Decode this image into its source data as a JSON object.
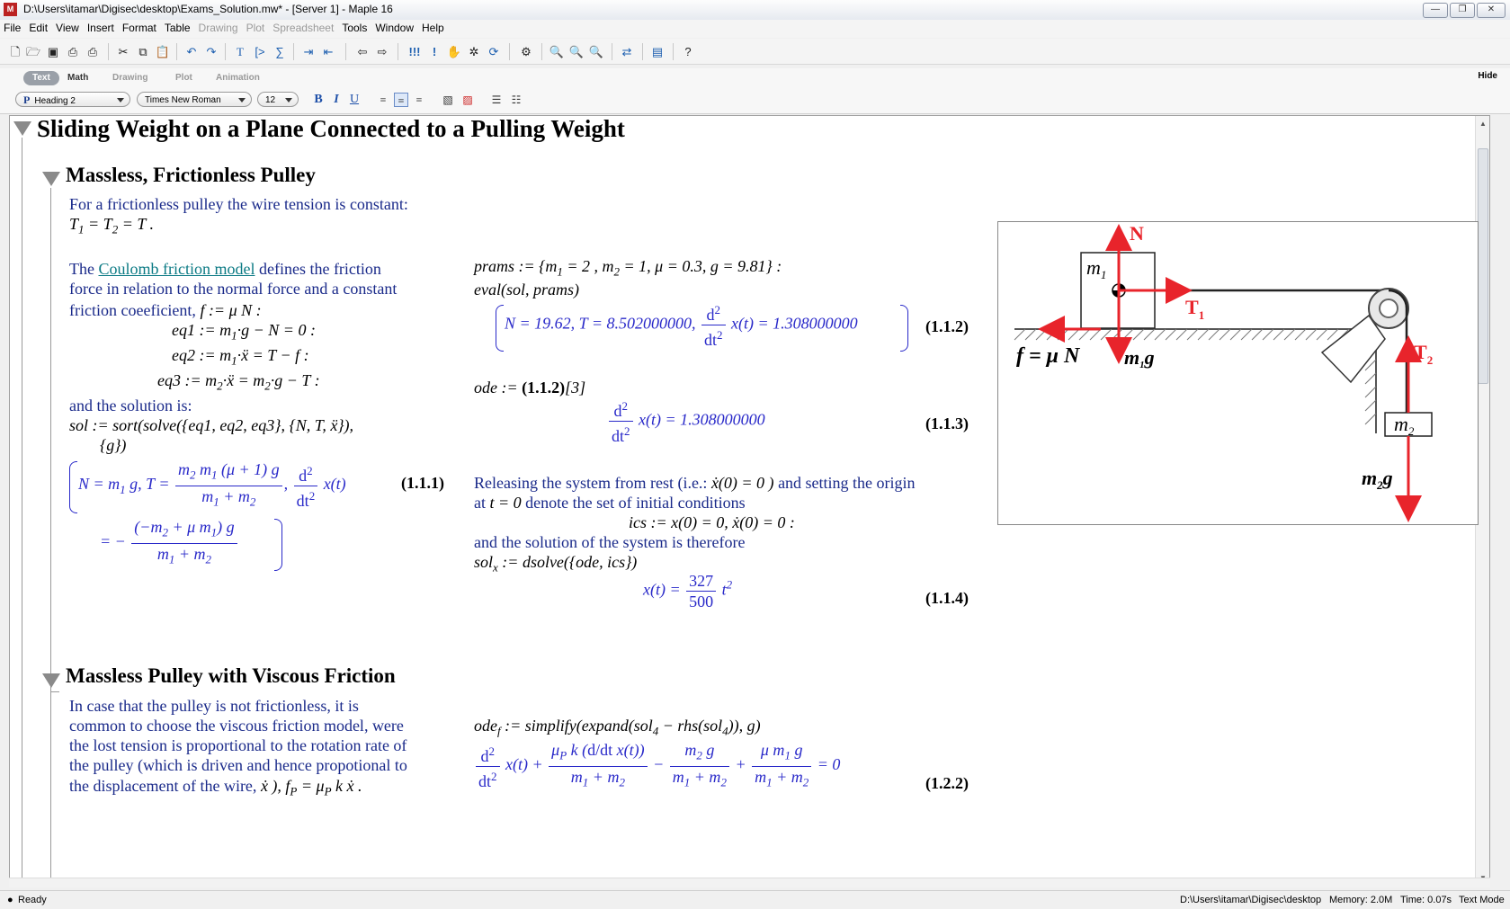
{
  "window": {
    "title": "D:\\Users\\itamar\\Digisec\\desktop\\Exams_Solution.mw* - [Server 1] - Maple 16",
    "app_icon": "maple-leaf-icon"
  },
  "menubar": {
    "items": [
      {
        "label": "File",
        "enabled": true
      },
      {
        "label": "Edit",
        "enabled": true
      },
      {
        "label": "View",
        "enabled": true
      },
      {
        "label": "Insert",
        "enabled": true
      },
      {
        "label": "Format",
        "enabled": true
      },
      {
        "label": "Table",
        "enabled": true
      },
      {
        "label": "Drawing",
        "enabled": false
      },
      {
        "label": "Plot",
        "enabled": false
      },
      {
        "label": "Spreadsheet",
        "enabled": false
      },
      {
        "label": "Tools",
        "enabled": true
      },
      {
        "label": "Window",
        "enabled": true
      },
      {
        "label": "Help",
        "enabled": true
      }
    ]
  },
  "toolbar": {
    "icons": [
      "new-document-icon",
      "open-icon",
      "save-icon",
      "print-icon",
      "print-preview-icon",
      "cut-icon",
      "copy-icon",
      "paste-icon",
      "undo-icon",
      "redo-icon",
      "text-mode-icon",
      "math-prompt-icon",
      "sum-icon",
      "indent-icon",
      "outdent-icon",
      "back-icon",
      "forward-icon",
      "execute-all-icon",
      "execute-icon",
      "interrupt-icon",
      "debug-icon",
      "restart-icon",
      "settings-icon",
      "zoom-100-icon",
      "zoom-150-icon",
      "zoom-200-icon",
      "swap-icon",
      "document-block-icon",
      "help-icon"
    ]
  },
  "context_bar": {
    "tabs": [
      "Text",
      "Math",
      "Drawing",
      "Plot",
      "Animation"
    ],
    "active_tab": "Text",
    "hide_label": "Hide",
    "style_select": "Heading 2",
    "style_icon": "P",
    "font_select": "Times New Roman",
    "size_select": "12",
    "format_buttons": {
      "bold": "B",
      "italic": "I",
      "underline": "U"
    }
  },
  "document": {
    "title": "Sliding Weight on a Plane Connected to a Pulling Weight",
    "section1": {
      "heading": "Massless, Frictionless Pulley",
      "intro_line1": "For a frictionless pulley the wire tension is constant:",
      "coulomb_pre": "The ",
      "coulomb_link": "Coulomb friction model",
      "coulomb_post": " defines the friction",
      "coulomb_line2": "force in relation to the normal force and a constant",
      "coulomb_line3": "friction coeeficient, ",
      "solution_text": "and the solution is:",
      "label_111": "(1.1.1)",
      "eval_cmd": "eval",
      "label_112": "(1.1.2)",
      "output_112": "N = 19.62, T = 8.502000000,",
      "output_112_rhs": "x(t) = 1.308000000",
      "label_113": "(1.1.3)",
      "output_113": "x(t) = 1.308000000",
      "releasing_line1": "Releasing the system from rest (i.e.: ",
      "releasing_line1b": " and setting the origin",
      "releasing_line2a": "at ",
      "releasing_line2b": " denote the set of initial conditions",
      "solution_system": "and the solution of the system is therefore",
      "label_114": "(1.1.4)",
      "frac_114_num": "327",
      "frac_114_den": "500"
    },
    "section2": {
      "heading": "Massless Pulley with Viscous Friction",
      "lines": [
        "In case that the pulley is not frictionless, it is",
        "common to choose the viscous friction model, were",
        "the lost tension is proportional to the rotation rate of",
        "the pulley (which is driven and hence propotional to",
        "the displacement of the wire, "
      ],
      "label_122": "(1.2.2)"
    },
    "figure": {
      "labels": {
        "N": "N",
        "m1": "m",
        "m1_sub": "1",
        "T1": "T",
        "T1_sub": "1",
        "f": "f = μ N",
        "m1g": "m",
        "m1g_sub": "1",
        "m1g_g": "g",
        "T2": "T",
        "T2_sub": "2",
        "m2": "m",
        "m2_sub": "2",
        "m2g": "m",
        "m2g_sub": "2",
        "m2g_g": "g"
      },
      "colors": {
        "force": "#e8242b",
        "line": "#000000",
        "hatch": "#888888"
      }
    }
  },
  "status": {
    "ready": "Ready",
    "path": "D:\\Users\\itamar\\Digisec\\desktop",
    "memory": "Memory: 2.0M",
    "time": "Time: 0.07s",
    "mode": "Text Mode"
  },
  "colors": {
    "text_blue": "#1a2a8a",
    "output_blue": "#2929c9",
    "link_teal": "#0b7a84"
  }
}
